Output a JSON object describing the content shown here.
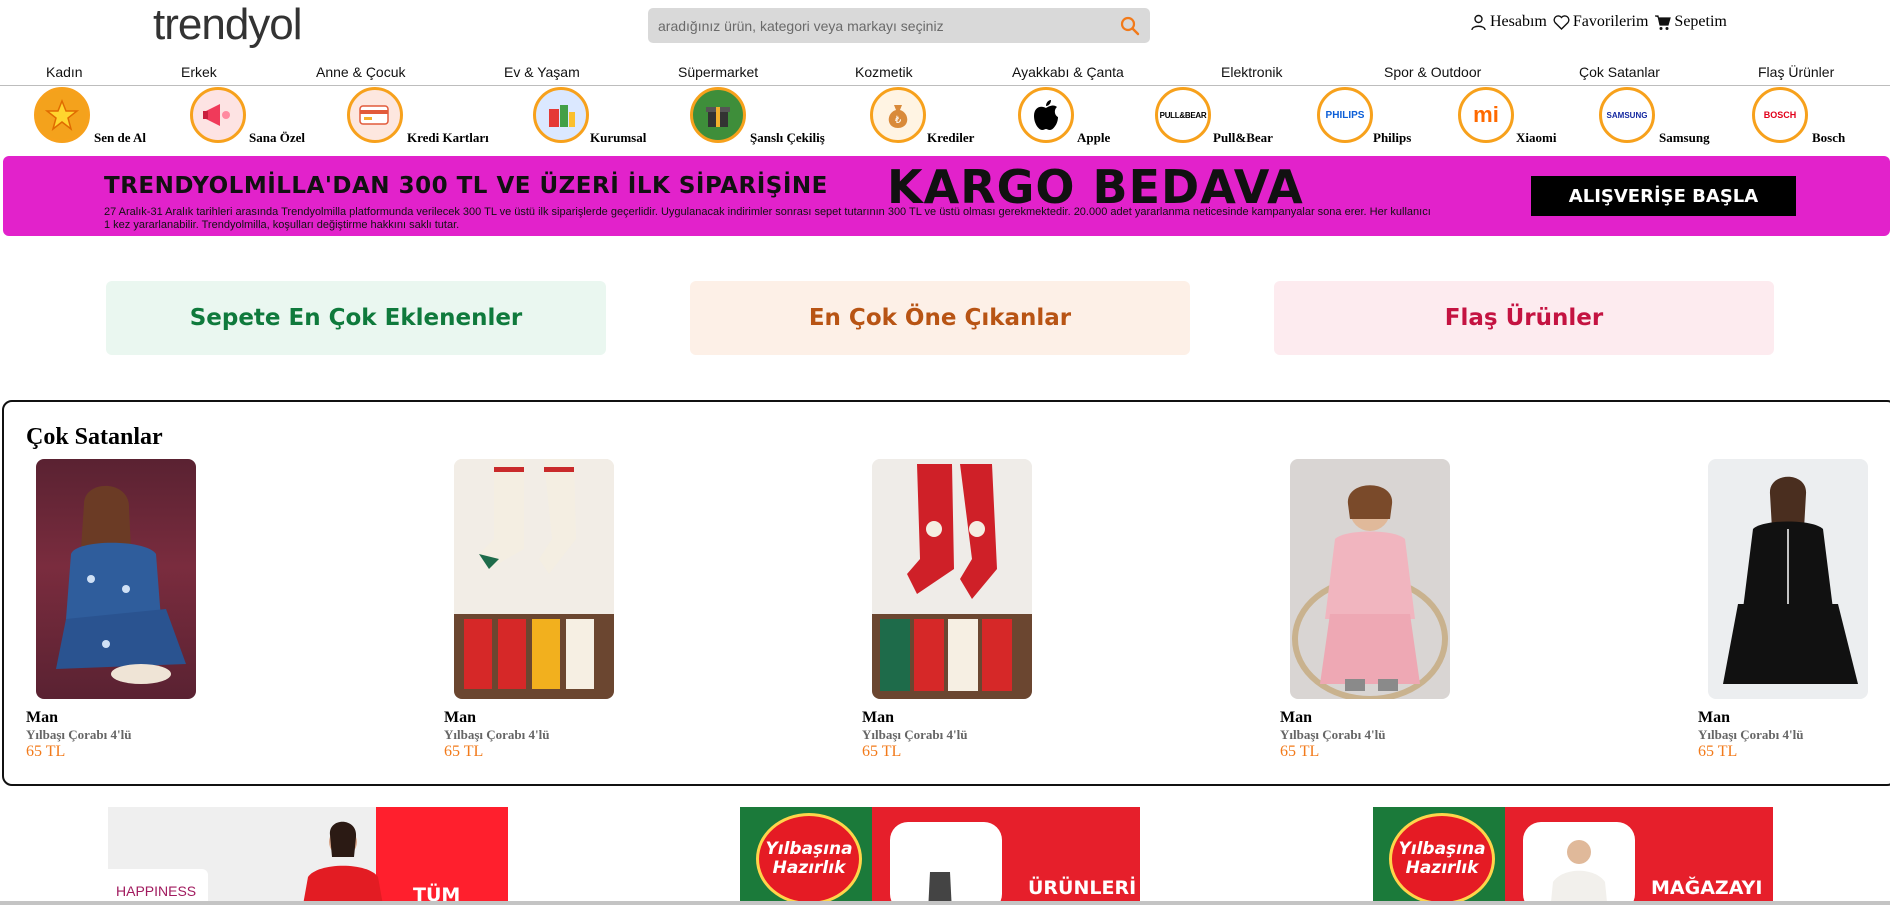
{
  "header": {
    "logo": "trendyol",
    "search_placeholder": "aradığınız ürün, kategori veya markayı seçiniz",
    "account": "Hesabım",
    "favorites": "Favorilerim",
    "cart": "Sepetim"
  },
  "categories": [
    "Kadın",
    "Erkek",
    "Anne & Çocuk",
    "Ev & Yaşam",
    "Süpermarket",
    "Kozmetik",
    "Ayakkabı & Çanta",
    "Elektronik",
    "Spor & Outdoor",
    "Çok Satanlar",
    "Flaş Ürünler"
  ],
  "stories": [
    "Sen de Al",
    "Sana Özel",
    "Kredi Kartları",
    "Kurumsal",
    "Şanslı Çekiliş",
    "Krediler",
    "Apple",
    "Pull&Bear",
    "Philips",
    "Xiaomi",
    "Samsung",
    "Bosch"
  ],
  "story_logos": [
    "",
    "",
    "",
    "",
    "",
    "",
    "",
    "PULL&BEAR",
    "PHILIPS",
    "mi",
    "SAMSUNG",
    "BOSCH"
  ],
  "banner": {
    "headline": "TRENDYOLMİLLA'DAN 300 TL VE ÜZERİ İLK SİPARİŞİNE",
    "big": "KARGO BEDAVA",
    "fineprint": "27 Aralık-31 Aralık tarihleri arasında Trendyolmilla platformunda verilecek 300 TL ve üstü ilk siparişlerde geçerlidir. Uygulanacak indirimler sonrası sepet tutarının 300 TL ve üstü olması gerekmektedir. 20.000 adet yararlanma neticesinde kampanyalar sona erer. Her kullanıcı 1 kez yararlanabilir. Trendyolmilla, koşulları değiştirme hakkını saklı tutar.",
    "cta": "ALIŞVERİŞE BAŞLA"
  },
  "pills": [
    "Sepete En Çok Eklenenler",
    "En Çok Öne Çıkanlar",
    "Flaş Ürünler"
  ],
  "bestsellers": {
    "title": "Çok Satanlar",
    "products": [
      {
        "brand": "Man",
        "name": "Yılbaşı Çorabı 4'lü",
        "price": "65 TL"
      },
      {
        "brand": "Man",
        "name": "Yılbaşı Çorabı 4'lü",
        "price": "65 TL"
      },
      {
        "brand": "Man",
        "name": "Yılbaşı Çorabı 4'lü",
        "price": "65 TL"
      },
      {
        "brand": "Man",
        "name": "Yılbaşı Çorabı 4'lü",
        "price": "65 TL"
      },
      {
        "brand": "Man",
        "name": "Yılbaşı Çorabı 4'lü",
        "price": "65 TL"
      }
    ]
  },
  "promos": {
    "p1_tag": "HAPPINESS",
    "p1_text": "TÜM",
    "badge": "Yılbaşına Hazırlık",
    "p2_text": "ÜRÜNLERİ",
    "p3_text": "MAĞAZAYI"
  },
  "colors": {
    "accent": "#f27a1a",
    "story_ring": "#f7a11c",
    "banner": "#e222cb"
  }
}
